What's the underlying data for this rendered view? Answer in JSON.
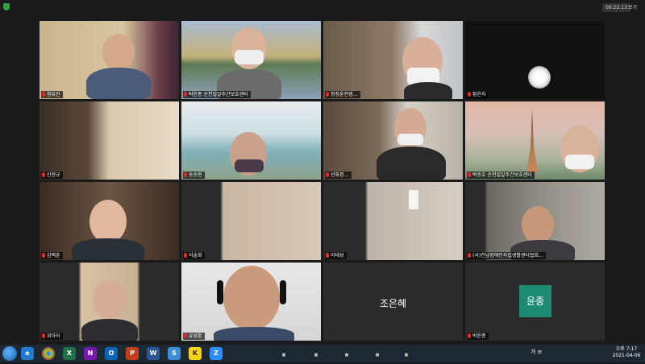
{
  "window": {
    "timer": "06:22:13",
    "view_label": "보기"
  },
  "participants": [
    {
      "name": "정유진",
      "muted": true,
      "kind": "video"
    },
    {
      "name": "박윤종 순천밀알주간보호센터",
      "muted": true,
      "kind": "video"
    },
    {
      "name": "청정훈전병…",
      "muted": true,
      "kind": "video"
    },
    {
      "name": "황윤지",
      "muted": true,
      "kind": "video"
    },
    {
      "name": "신현규",
      "muted": true,
      "kind": "video"
    },
    {
      "name": "송승현",
      "muted": true,
      "kind": "video"
    },
    {
      "name": "선화정…",
      "muted": true,
      "kind": "video"
    },
    {
      "name": "박승호 순천밀알주간보호센터",
      "muted": true,
      "kind": "video"
    },
    {
      "name": "김택훈",
      "muted": true,
      "kind": "video",
      "active": true
    },
    {
      "name": "이솔희",
      "muted": true,
      "kind": "video"
    },
    {
      "name": "이태성",
      "muted": true,
      "kind": "video"
    },
    {
      "name": "(사)전남장애인자립생활센터협회…",
      "muted": true,
      "kind": "video"
    },
    {
      "name": "위아라",
      "muted": true,
      "kind": "video"
    },
    {
      "name": "유성훈",
      "muted": true,
      "kind": "video"
    },
    {
      "name": "조은혜",
      "muted": true,
      "kind": "name"
    },
    {
      "name": "박윤종",
      "muted": true,
      "kind": "avatar",
      "avatar_text": "윤종"
    }
  ],
  "taskbar": {
    "apps": [
      {
        "icon": "ie-icon",
        "label": "e",
        "color": "#1f7ad1"
      },
      {
        "icon": "chrome-icon",
        "label": "",
        "color": "#d93025"
      },
      {
        "icon": "excel-icon",
        "label": "X",
        "color": "#1e7145"
      },
      {
        "icon": "onenote-icon",
        "label": "N",
        "color": "#7719aa"
      },
      {
        "icon": "outlook-icon",
        "label": "O",
        "color": "#0a64b8"
      },
      {
        "icon": "powerpoint-icon",
        "label": "P",
        "color": "#c43e1c"
      },
      {
        "icon": "word-icon",
        "label": "W",
        "color": "#2b579a"
      },
      {
        "icon": "store-icon",
        "label": "S",
        "color": "#3c8ed9"
      },
      {
        "icon": "kakaotalk-icon",
        "label": "K",
        "color": "#f7d417"
      },
      {
        "icon": "zoom-icon",
        "label": "Z",
        "color": "#2d8cff"
      }
    ],
    "ime_text": "가 ≡",
    "time": "오후 7:17",
    "date": "2021-04-06"
  }
}
